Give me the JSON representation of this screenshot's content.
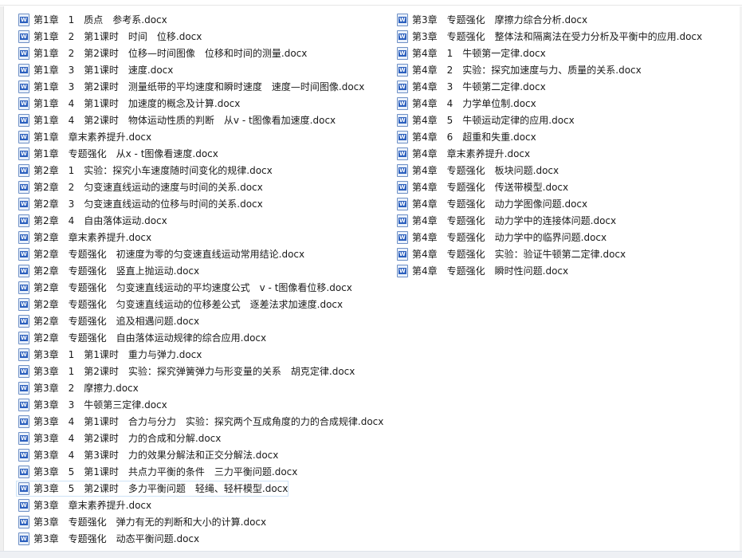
{
  "files": {
    "column1": [
      "第1章　1　质点　参考系.docx",
      "第1章　2　第1课时　时间　位移.docx",
      "第1章　2　第2课时　位移—时间图像　位移和时间的测量.docx",
      "第1章　3　第1课时　速度.docx",
      "第1章　3　第2课时　测量纸带的平均速度和瞬时速度　速度—时间图像.docx",
      "第1章　4　第1课时　加速度的概念及计算.docx",
      "第1章　4　第2课时　物体运动性质的判断　从v - t图像看加速度.docx",
      "第1章　章末素养提升.docx",
      "第1章　专题强化　从x - t图像看速度.docx",
      "第2章　1　实验：探究小车速度随时间变化的规律.docx",
      "第2章　2　匀变速直线运动的速度与时间的关系.docx",
      "第2章　3　匀变速直线运动的位移与时间的关系.docx",
      "第2章　4　自由落体运动.docx",
      "第2章　章末素养提升.docx",
      "第2章　专题强化　初速度为零的匀变速直线运动常用结论.docx",
      "第2章　专题强化　竖直上抛运动.docx",
      "第2章　专题强化　匀变速直线运动的平均速度公式　v - t图像看位移.docx",
      "第2章　专题强化　匀变速直线运动的位移差公式　逐差法求加速度.docx",
      "第2章　专题强化　追及相遇问题.docx",
      "第2章　专题强化　自由落体运动规律的综合应用.docx",
      "第3章　1　第1课时　重力与弹力.docx",
      "第3章　1　第2课时　实验：探究弹簧弹力与形变量的关系　胡克定律.docx",
      "第3章　2　摩擦力.docx",
      "第3章　3　牛顿第三定律.docx",
      "第3章　4　第1课时　合力与分力　实验：探究两个互成角度的力的合成规律.docx",
      "第3章　4　第2课时　力的合成和分解.docx",
      "第3章　4　第3课时　力的效果分解法和正交分解法.docx",
      "第3章　5　第1课时　共点力平衡的条件　三力平衡问题.docx",
      "第3章　5　第2课时　多力平衡问题　轻绳、轻杆模型.docx",
      "第3章　章末素养提升.docx",
      "第3章　专题强化　弹力有无的判断和大小的计算.docx",
      "第3章　专题强化　动态平衡问题.docx"
    ],
    "column2": [
      "第3章　专题强化　摩擦力综合分析.docx",
      "第3章　专题强化　整体法和隔离法在受力分析及平衡中的应用.docx",
      "第4章　1　牛顿第一定律.docx",
      "第4章　2　实验：探究加速度与力、质量的关系.docx",
      "第4章　3　牛顿第二定律.docx",
      "第4章　4　力学单位制.docx",
      "第4章　5　牛顿运动定律的应用.docx",
      "第4章　6　超重和失重.docx",
      "第4章　章末素养提升.docx",
      "第4章　专题强化　板块问题.docx",
      "第4章　专题强化　传送带模型.docx",
      "第4章　专题强化　动力学图像问题.docx",
      "第4章　专题强化　动力学中的连接体问题.docx",
      "第4章　专题强化　动力学中的临界问题.docx",
      "第4章　专题强化　实验：验证牛顿第二定律.docx",
      "第4章　专题强化　瞬时性问题.docx"
    ],
    "selected_index_column1": 28,
    "icon": "word-document-icon"
  }
}
